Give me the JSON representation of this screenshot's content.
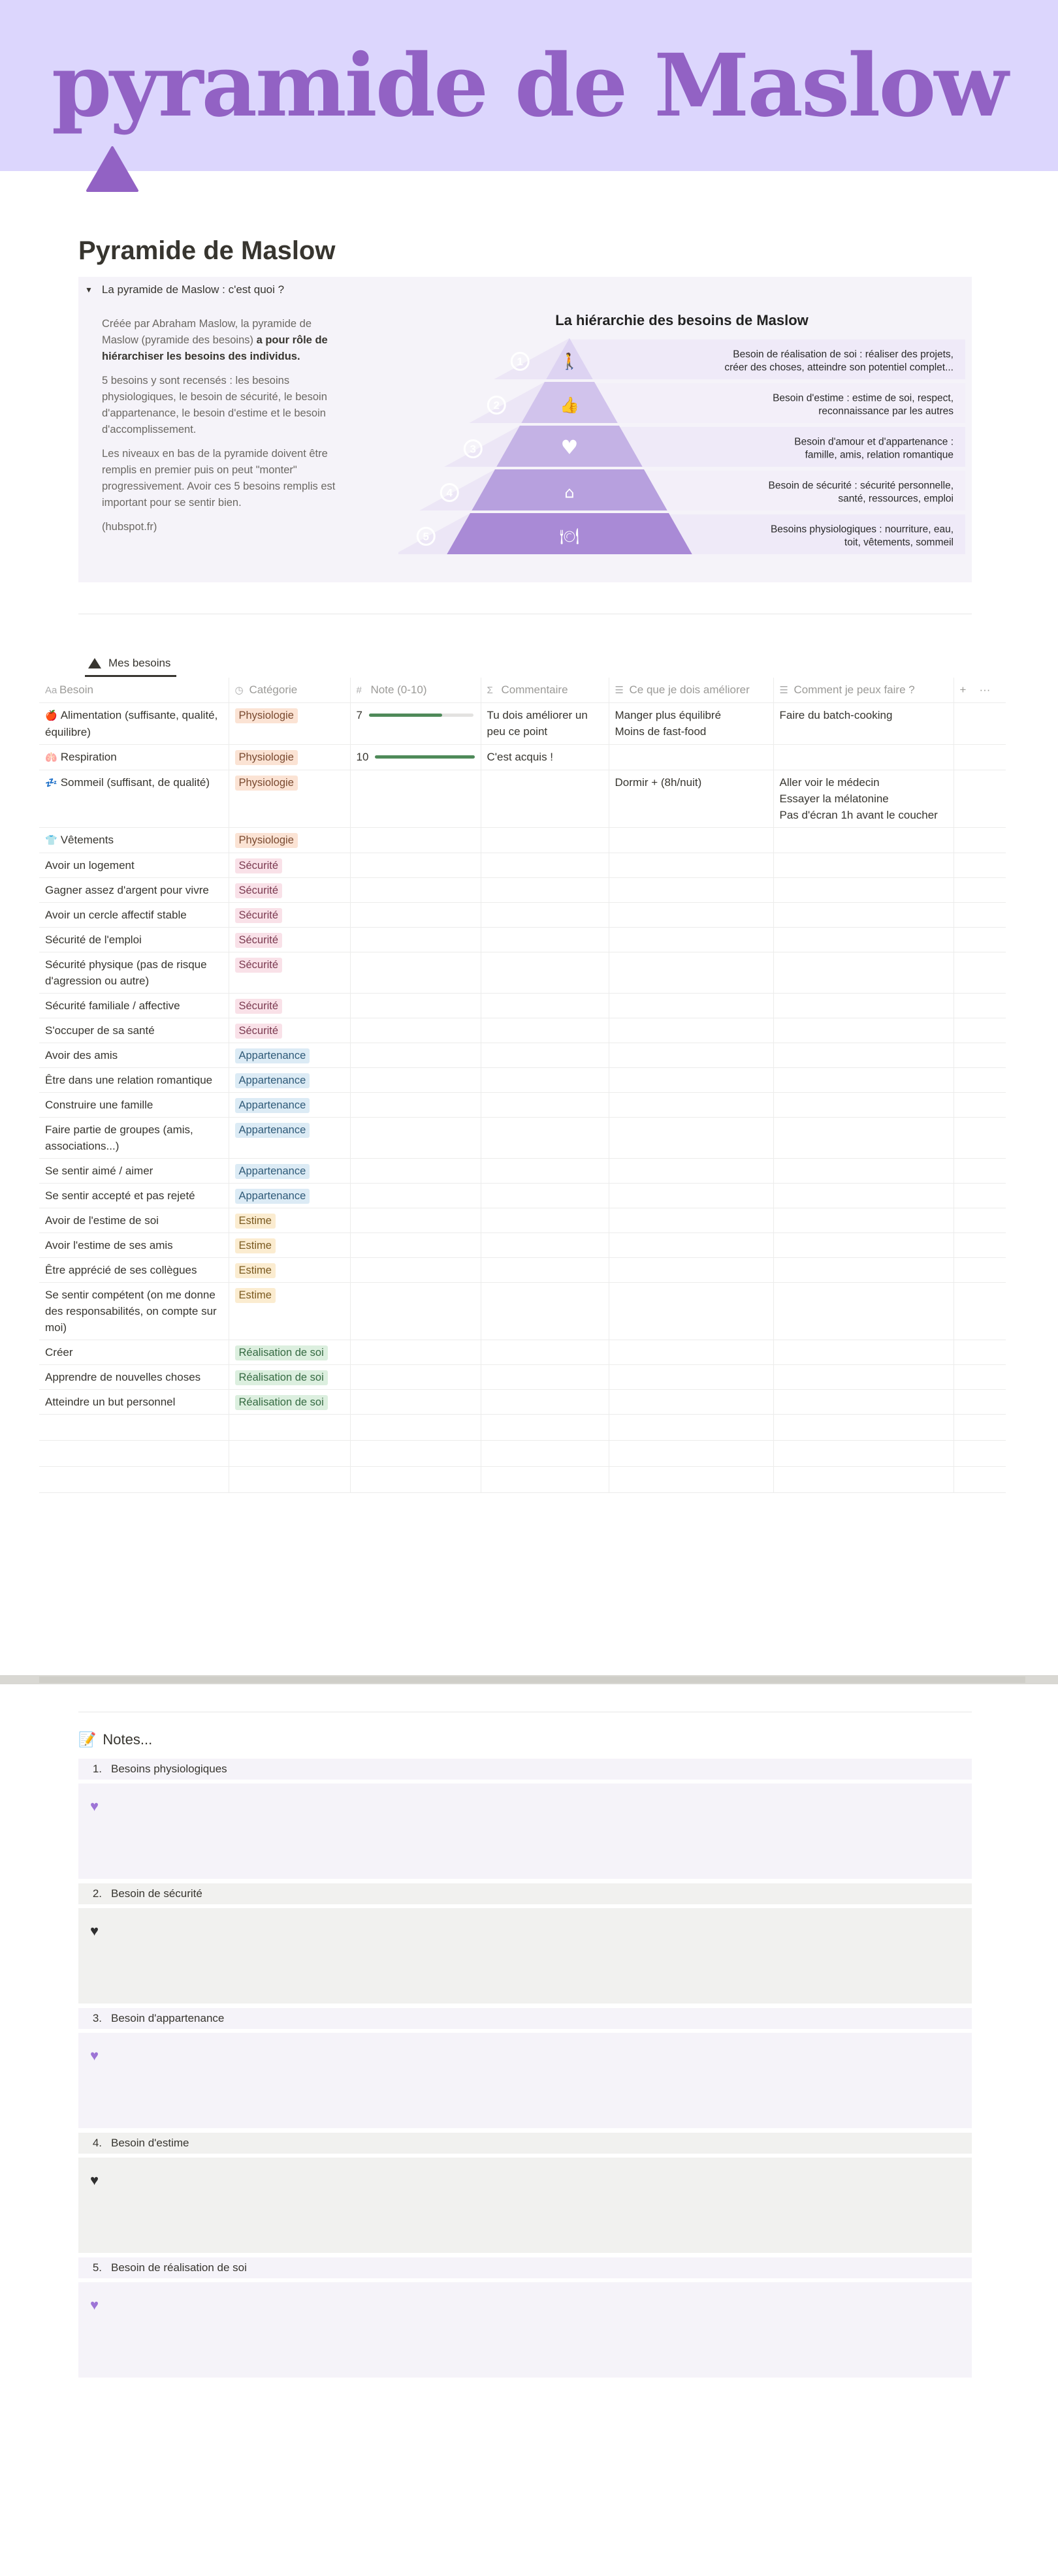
{
  "banner": {
    "title": "pyramide de Maslow"
  },
  "page": {
    "title": "Pyramide de Maslow"
  },
  "toggle": {
    "label": "La pyramide de Maslow : c'est quoi ?",
    "p1_a": "Créée par Abraham Maslow, la pyramide de Maslow (pyramide des besoins) ",
    "p1_b": "a pour rôle de hiérarchiser les besoins des individus.",
    "p2": "5 besoins y sont recensés : les besoins physiologiques, le besoin de sécurité, le besoin d'appartenance, le besoin d'estime et le besoin d'accomplissement.",
    "p3": "Les niveaux en bas de la pyramide doivent être remplis en premier puis on peut \"monter\" progressivement. Avoir ces 5 besoins remplis est important pour se sentir bien.",
    "p4": "(hubspot.fr)"
  },
  "pyramid": {
    "title": "La hiérarchie des besoins de Maslow",
    "levels": [
      {
        "num": "1",
        "icon": "person-icon",
        "line1": "Besoin de réalisation de soi : réaliser des projets,",
        "line2": "créer des choses, atteindre son potentiel complet..."
      },
      {
        "num": "2",
        "icon": "thumbs-up-icon",
        "line1": "Besoin d'estime : estime de soi, respect,",
        "line2": "reconnaissance par les autres"
      },
      {
        "num": "3",
        "icon": "heart-icon",
        "line1": "Besoin d'amour et d'appartenance :",
        "line2": "famille, amis, relation romantique"
      },
      {
        "num": "4",
        "icon": "home-icon",
        "line1": "Besoin de sécurité : sécurité personnelle,",
        "line2": "santé, ressources, emploi"
      },
      {
        "num": "5",
        "icon": "meal-icon",
        "line1": "Besoins physiologiques : nourriture, eau,",
        "line2": "toit, vêtements, sommeil"
      }
    ]
  },
  "database": {
    "tab_label": "Mes besoins",
    "columns": [
      "Besoin",
      "Catégorie",
      "Note (0-10)",
      "Commentaire",
      "Ce que je dois améliorer",
      "Comment je peux faire ?"
    ],
    "column_icons": [
      "Aa",
      "◷",
      "#",
      "Σ",
      "☰",
      "☰"
    ],
    "add_label": "+",
    "more_label": "···",
    "category_colors": {
      "Physiologie": {
        "bg": "#fbe3d4",
        "fg": "#7a4a30"
      },
      "Sécurité": {
        "bg": "#f9e1e8",
        "fg": "#7b3a50"
      },
      "Appartenance": {
        "bg": "#dcebf5",
        "fg": "#2f5a78"
      },
      "Estime": {
        "bg": "#fbecd0",
        "fg": "#7a5a20"
      },
      "Réalisation de soi": {
        "bg": "#dcefdf",
        "fg": "#356a42"
      }
    },
    "rows": [
      {
        "emoji": "🍎",
        "name": "Alimentation (suffisante, qualité, équilibre)",
        "category": "Physiologie",
        "note": "7",
        "progress": 0.7,
        "comment": "Tu dois améliorer un peu ce point",
        "improve": [
          "Manger plus équilibré",
          "Moins de fast-food"
        ],
        "how": [
          "Faire du batch-cooking"
        ]
      },
      {
        "emoji": "🫁",
        "name": "Respiration",
        "category": "Physiologie",
        "note": "10",
        "progress": 1.0,
        "comment": "C'est acquis !",
        "improve": [],
        "how": []
      },
      {
        "emoji": "💤",
        "name": "Sommeil (suffisant, de qualité)",
        "category": "Physiologie",
        "note": "",
        "progress": null,
        "comment": "",
        "improve": [
          "Dormir + (8h/nuit)"
        ],
        "how": [
          "Aller voir le médecin",
          "Essayer la mélatonine",
          "Pas d'écran 1h avant le coucher"
        ]
      },
      {
        "emoji": "👕",
        "name": "Vêtements",
        "category": "Physiologie",
        "note": "",
        "progress": null,
        "comment": "",
        "improve": [],
        "how": []
      },
      {
        "emoji": "",
        "name": "Avoir un logement",
        "category": "Sécurité",
        "note": "",
        "progress": null,
        "comment": "",
        "improve": [],
        "how": []
      },
      {
        "emoji": "",
        "name": "Gagner assez d'argent pour vivre",
        "category": "Sécurité",
        "note": "",
        "progress": null,
        "comment": "",
        "improve": [],
        "how": []
      },
      {
        "emoji": "",
        "name": "Avoir un cercle affectif stable",
        "category": "Sécurité",
        "note": "",
        "progress": null,
        "comment": "",
        "improve": [],
        "how": []
      },
      {
        "emoji": "",
        "name": "Sécurité de l'emploi",
        "category": "Sécurité",
        "note": "",
        "progress": null,
        "comment": "",
        "improve": [],
        "how": []
      },
      {
        "emoji": "",
        "name": "Sécurité physique (pas de risque d'agression ou autre)",
        "category": "Sécurité",
        "note": "",
        "progress": null,
        "comment": "",
        "improve": [],
        "how": []
      },
      {
        "emoji": "",
        "name": "Sécurité familiale / affective",
        "category": "Sécurité",
        "note": "",
        "progress": null,
        "comment": "",
        "improve": [],
        "how": []
      },
      {
        "emoji": "",
        "name": "S'occuper de sa santé",
        "category": "Sécurité",
        "note": "",
        "progress": null,
        "comment": "",
        "improve": [],
        "how": []
      },
      {
        "emoji": "",
        "name": "Avoir des amis",
        "category": "Appartenance",
        "note": "",
        "progress": null,
        "comment": "",
        "improve": [],
        "how": []
      },
      {
        "emoji": "",
        "name": "Être dans une relation romantique",
        "category": "Appartenance",
        "note": "",
        "progress": null,
        "comment": "",
        "improve": [],
        "how": []
      },
      {
        "emoji": "",
        "name": "Construire une famille",
        "category": "Appartenance",
        "note": "",
        "progress": null,
        "comment": "",
        "improve": [],
        "how": []
      },
      {
        "emoji": "",
        "name": "Faire partie de groupes (amis, associations...)",
        "category": "Appartenance",
        "note": "",
        "progress": null,
        "comment": "",
        "improve": [],
        "how": []
      },
      {
        "emoji": "",
        "name": "Se sentir aimé / aimer",
        "category": "Appartenance",
        "note": "",
        "progress": null,
        "comment": "",
        "improve": [],
        "how": []
      },
      {
        "emoji": "",
        "name": "Se sentir accepté et pas rejeté",
        "category": "Appartenance",
        "note": "",
        "progress": null,
        "comment": "",
        "improve": [],
        "how": []
      },
      {
        "emoji": "",
        "name": "Avoir de l'estime de soi",
        "category": "Estime",
        "note": "",
        "progress": null,
        "comment": "",
        "improve": [],
        "how": []
      },
      {
        "emoji": "",
        "name": "Avoir l'estime de ses amis",
        "category": "Estime",
        "note": "",
        "progress": null,
        "comment": "",
        "improve": [],
        "how": []
      },
      {
        "emoji": "",
        "name": "Être apprécié de ses collègues",
        "category": "Estime",
        "note": "",
        "progress": null,
        "comment": "",
        "improve": [],
        "how": []
      },
      {
        "emoji": "",
        "name": "Se sentir compétent (on me donne des responsabilités, on compte sur moi)",
        "category": "Estime",
        "note": "",
        "progress": null,
        "comment": "",
        "improve": [],
        "how": []
      },
      {
        "emoji": "",
        "name": "Créer",
        "category": "Réalisation de soi",
        "note": "",
        "progress": null,
        "comment": "",
        "improve": [],
        "how": []
      },
      {
        "emoji": "",
        "name": "Apprendre de nouvelles choses",
        "category": "Réalisation de soi",
        "note": "",
        "progress": null,
        "comment": "",
        "improve": [],
        "how": []
      },
      {
        "emoji": "",
        "name": "Atteindre un but personnel",
        "category": "Réalisation de soi",
        "note": "",
        "progress": null,
        "comment": "",
        "improve": [],
        "how": []
      }
    ]
  },
  "notes": {
    "title": "Notes...",
    "title_emoji": "📝",
    "items": [
      {
        "num": "1.",
        "label": "Besoins physiologiques",
        "heart_color": "#9d74d6",
        "bg": "#f5f3f9"
      },
      {
        "num": "2.",
        "label": "Besoin de sécurité",
        "heart_color": "#2f2f2f",
        "bg": "#f1f1ef"
      },
      {
        "num": "3.",
        "label": "Besoin d'appartenance",
        "heart_color": "#9d74d6",
        "bg": "#f5f3f9"
      },
      {
        "num": "4.",
        "label": "Besoin d'estime",
        "heart_color": "#2f2f2f",
        "bg": "#f1f1ef"
      },
      {
        "num": "5.",
        "label": "Besoin de réalisation de soi",
        "heart_color": "#9d74d6",
        "bg": "#f5f3f9"
      }
    ]
  }
}
